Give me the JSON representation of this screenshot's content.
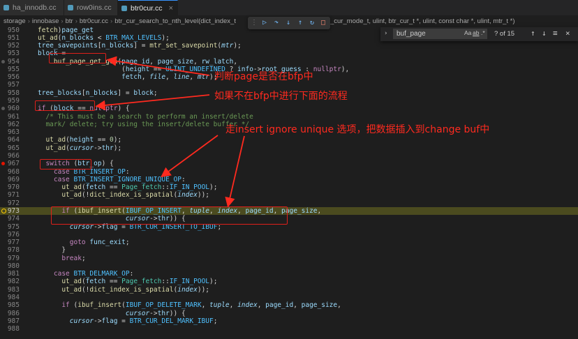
{
  "tabs": [
    {
      "label": "ha_innodb.cc",
      "active": false
    },
    {
      "label": "row0ins.cc",
      "active": false
    },
    {
      "label": "btr0cur.cc",
      "active": true
    }
  ],
  "breadcrumb": [
    "storage",
    "innobase",
    "btr",
    "btr0cur.cc",
    "btr_cur_search_to_nth_level(dict_index_t",
    "_cur_mode_t, ulint, btr_cur_t *, ulint, const char *, ulint, mtr_t *)"
  ],
  "find": {
    "value": "buf_page",
    "count": "? of 15",
    "opt_case": "Aa",
    "opt_word": "ab",
    "opt_regex": ".*"
  },
  "lines": [
    {
      "n": "950",
      "html": "<span class=\"fn\">fetch</span>)<span class=\"var\">page_get</span>"
    },
    {
      "n": "951",
      "html": "<span class=\"fn\">ut_ad</span>(<span class=\"var\">n_blocks</span> &lt; <span class=\"mac\">BTR_MAX_LEVELS</span>);"
    },
    {
      "n": "952",
      "html": "<span class=\"var\">tree_savepoints</span>[<span class=\"var\">n_blocks</span>] = <span class=\"fn\">mtr_set_savepoint</span>(<span class=\"it\">mtr</span>);"
    },
    {
      "n": "953",
      "html": "<span class=\"var\">block</span> ="
    },
    {
      "n": "954",
      "html": "    <span class=\"fn\">buf_page_get_gen</span>(<span class=\"var\">page_id</span>, <span class=\"var\">page_size</span>, <span class=\"var\">rw_latch</span>,"
    },
    {
      "n": "955",
      "html": "                     (<span class=\"var\">height</span> == <span class=\"mac\">ULINT_UNDEFINED</span> ? <span class=\"var\">info</span>-&gt;<span class=\"var\">root_guess</span> : <span class=\"kw\">nullptr</span>),"
    },
    {
      "n": "956",
      "html": "                     <span class=\"var\">fetch</span>, <span class=\"it\">file</span>, <span class=\"it\">line</span>, <span class=\"it\">mtr</span>);"
    },
    {
      "n": "957",
      "html": ""
    },
    {
      "n": "958",
      "html": "<span class=\"var\">tree_blocks</span>[<span class=\"var\">n_blocks</span>] = <span class=\"var\">block</span>;"
    },
    {
      "n": "959",
      "html": ""
    },
    {
      "n": "960",
      "html": "<span class=\"kw\">if</span> (<span class=\"var\">block</span> == <span class=\"kw\">nullptr</span>) {"
    },
    {
      "n": "961",
      "html": "  <span class=\"cm\">/* This must be a search to perform an insert/delete</span>"
    },
    {
      "n": "962",
      "html": "<span class=\"cm\">  mark/ delete; try using the insert/delete buffer */</span>"
    },
    {
      "n": "963",
      "html": ""
    },
    {
      "n": "964",
      "html": "  <span class=\"fn\">ut_ad</span>(<span class=\"var\">height</span> == <span class=\"num\">0</span>);"
    },
    {
      "n": "965",
      "html": "  <span class=\"fn\">ut_ad</span>(<span class=\"it\">cursor</span>-&gt;<span class=\"var\">thr</span>);"
    },
    {
      "n": "966",
      "html": ""
    },
    {
      "n": "967",
      "html": "  <span class=\"kw\">switch</span> (<span class=\"var\">btr_op</span>) {"
    },
    {
      "n": "968",
      "html": "    <span class=\"kw\">case</span> <span class=\"mac\">BTR_INSERT_OP</span>:"
    },
    {
      "n": "969",
      "html": "    <span class=\"kw\">case</span> <span class=\"mac\">BTR_INSERT_IGNORE_UNIQUE_OP</span>:"
    },
    {
      "n": "970",
      "html": "      <span class=\"fn\">ut_ad</span>(<span class=\"var\">fetch</span> == <span class=\"ty\">Page_fetch</span>::<span class=\"mac\">IF_IN_POOL</span>);"
    },
    {
      "n": "971",
      "html": "      <span class=\"fn\">ut_ad</span>(!<span class=\"fn\">dict_index_is_spatial</span>(<span class=\"it\">index</span>));"
    },
    {
      "n": "972",
      "html": ""
    },
    {
      "n": "973",
      "html": "      <span class=\"kw\">if</span> (<span class=\"fn\">ibuf_insert</span>(<span class=\"mac\">IBUF_OP_INSERT</span>, <span class=\"it\">tuple</span>, <span class=\"it\">index</span>, <span class=\"var\">page_id</span>, <span class=\"var\">page_size</span>,"
    },
    {
      "n": "974",
      "html": "                      <span class=\"it\">cursor</span>-&gt;<span class=\"var\">thr</span>)) {"
    },
    {
      "n": "975",
      "html": "        <span class=\"it\">cursor</span>-&gt;<span class=\"var\">flag</span> = <span class=\"mac\">BTR_CUR_INSERT_TO_IBUF</span>;"
    },
    {
      "n": "976",
      "html": ""
    },
    {
      "n": "977",
      "html": "        <span class=\"kw\">goto</span> <span class=\"var\">func_exit</span>;"
    },
    {
      "n": "978",
      "html": "      }"
    },
    {
      "n": "979",
      "html": "      <span class=\"kw\">break</span>;"
    },
    {
      "n": "980",
      "html": ""
    },
    {
      "n": "981",
      "html": "    <span class=\"kw\">case</span> <span class=\"mac\">BTR_DELMARK_OP</span>:"
    },
    {
      "n": "982",
      "html": "      <span class=\"fn\">ut_ad</span>(<span class=\"var\">fetch</span> == <span class=\"ty\">Page_fetch</span>::<span class=\"mac\">IF_IN_POOL</span>);"
    },
    {
      "n": "983",
      "html": "      <span class=\"fn\">ut_ad</span>(!<span class=\"fn\">dict_index_is_spatial</span>(<span class=\"it\">index</span>));"
    },
    {
      "n": "984",
      "html": ""
    },
    {
      "n": "985",
      "html": "      <span class=\"kw\">if</span> (<span class=\"fn\">ibuf_insert</span>(<span class=\"mac\">IBUF_OP_DELETE_MARK</span>, <span class=\"it\">tuple</span>, <span class=\"it\">index</span>, <span class=\"var\">page_id</span>, <span class=\"var\">page_size</span>,"
    },
    {
      "n": "986",
      "html": "                      <span class=\"it\">cursor</span>-&gt;<span class=\"var\">thr</span>)) {"
    },
    {
      "n": "987",
      "html": "        <span class=\"it\">cursor</span>-&gt;<span class=\"var\">flag</span> = <span class=\"mac\">BTR_CUR_DEL_MARK_IBUF</span>;"
    },
    {
      "n": "988",
      "html": ""
    }
  ],
  "annotations": {
    "a1": "判断page是否在bfp中",
    "a2": "如果不在bfp中进行下面的流程",
    "a3": "走insert ignore unique 选项，把数据插入到change buf中"
  },
  "colors": {
    "annotation": "#ff2a1f",
    "current_line": "#4b4b1f"
  }
}
